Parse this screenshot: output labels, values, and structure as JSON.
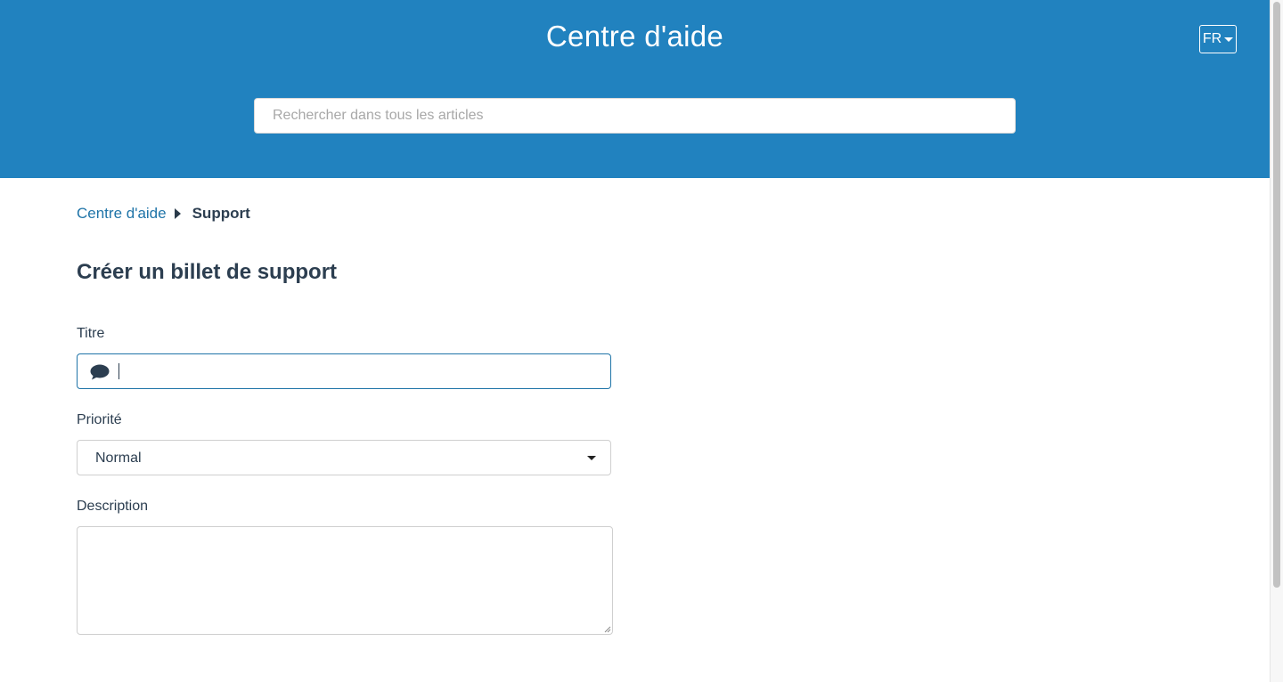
{
  "header": {
    "title": "Centre d'aide",
    "language_label": "FR",
    "background_color": "#2182bf"
  },
  "search": {
    "placeholder": "Rechercher dans tous les articles",
    "value": ""
  },
  "breadcrumb": {
    "home_label": "Centre d'aide",
    "current_label": "Support"
  },
  "form": {
    "heading": "Créer un billet de support",
    "title_field": {
      "label": "Titre",
      "value": "",
      "icon": "speech-bubble-icon"
    },
    "priority_field": {
      "label": "Priorité",
      "selected": "Normal"
    },
    "description_field": {
      "label": "Description",
      "value": ""
    }
  },
  "colors": {
    "accent": "#2182bf",
    "link": "#1f74a8",
    "text_dark": "#2c3e50"
  }
}
